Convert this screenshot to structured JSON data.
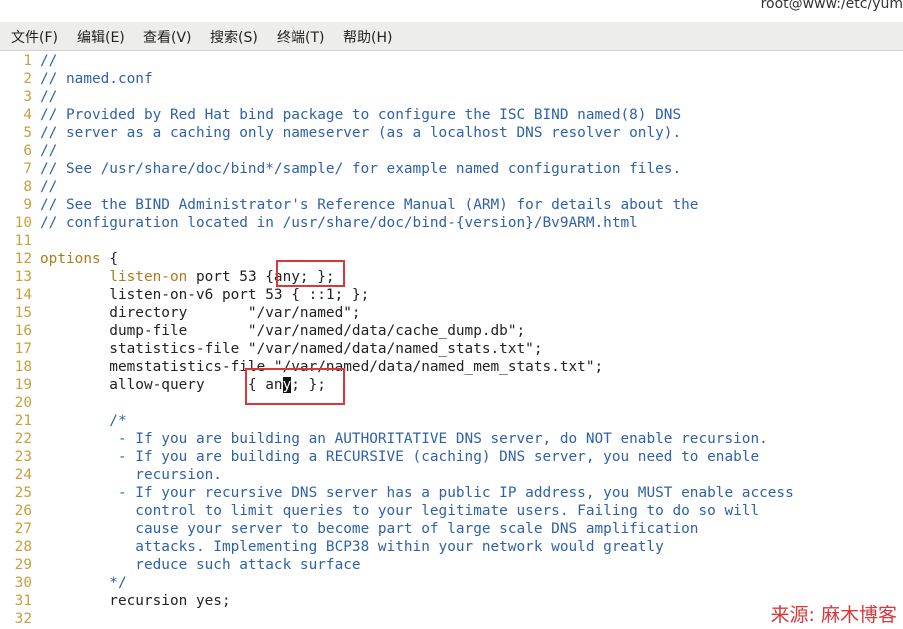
{
  "window": {
    "title": "root@www:/etc/yum"
  },
  "menu": [
    {
      "label": "文件(F)"
    },
    {
      "label": "编辑(E)"
    },
    {
      "label": "查看(V)"
    },
    {
      "label": "搜索(S)"
    },
    {
      "label": "终端(T)"
    },
    {
      "label": "帮助(H)"
    }
  ],
  "lines": [
    {
      "n": "1",
      "segs": [
        {
          "t": "//",
          "c": "cm"
        }
      ]
    },
    {
      "n": "2",
      "segs": [
        {
          "t": "// named.conf",
          "c": "cm"
        }
      ]
    },
    {
      "n": "3",
      "segs": [
        {
          "t": "//",
          "c": "cm"
        }
      ]
    },
    {
      "n": "4",
      "segs": [
        {
          "t": "// Provided by Red Hat bind package to configure the ISC BIND named(8) DNS",
          "c": "cm"
        }
      ]
    },
    {
      "n": "5",
      "segs": [
        {
          "t": "// server as a caching only nameserver (as a localhost DNS resolver only).",
          "c": "cm"
        }
      ]
    },
    {
      "n": "6",
      "segs": [
        {
          "t": "//",
          "c": "cm"
        }
      ]
    },
    {
      "n": "7",
      "segs": [
        {
          "t": "// See /usr/share/doc/bind*/sample/ for example named configuration files.",
          "c": "cm"
        }
      ]
    },
    {
      "n": "8",
      "segs": [
        {
          "t": "//",
          "c": "cm"
        }
      ]
    },
    {
      "n": "9",
      "segs": [
        {
          "t": "// See the BIND Administrator's Reference Manual (ARM) for details about the",
          "c": "cm"
        }
      ]
    },
    {
      "n": "10",
      "segs": [
        {
          "t": "// configuration located in /usr/share/doc/bind-{version}/Bv9ARM.html",
          "c": "cm"
        }
      ]
    },
    {
      "n": "11",
      "segs": []
    },
    {
      "n": "12",
      "segs": [
        {
          "t": "options",
          "c": "kw"
        },
        {
          "t": " {",
          "c": "tx"
        }
      ]
    },
    {
      "n": "13",
      "segs": [
        {
          "t": "        ",
          "c": "tx"
        },
        {
          "t": "listen-on",
          "c": "kw"
        },
        {
          "t": " port 53 {any; };",
          "c": "tx"
        }
      ]
    },
    {
      "n": "14",
      "segs": [
        {
          "t": "        listen-on-v6 port 53 { ::1; };",
          "c": "tx"
        }
      ]
    },
    {
      "n": "15",
      "segs": [
        {
          "t": "        directory       \"/var/named\";",
          "c": "tx"
        }
      ]
    },
    {
      "n": "16",
      "segs": [
        {
          "t": "        dump-file       \"/var/named/data/cache_dump.db\";",
          "c": "tx"
        }
      ]
    },
    {
      "n": "17",
      "segs": [
        {
          "t": "        statistics-file \"/var/named/data/named_stats.txt\";",
          "c": "tx"
        }
      ]
    },
    {
      "n": "18",
      "segs": [
        {
          "t": "        memstatistics-file \"/var/named/data/named_mem_stats.txt\";",
          "c": "tx"
        }
      ]
    },
    {
      "n": "19",
      "segs": [
        {
          "t": "        allow-query     { an",
          "c": "tx"
        },
        {
          "t": "y",
          "c": "cursor"
        },
        {
          "t": "; };",
          "c": "tx"
        }
      ]
    },
    {
      "n": "20",
      "segs": []
    },
    {
      "n": "21",
      "segs": [
        {
          "t": "        /*",
          "c": "cm"
        }
      ]
    },
    {
      "n": "22",
      "segs": [
        {
          "t": "         - If you are building an AUTHORITATIVE DNS server, do NOT enable recursion.",
          "c": "cm"
        }
      ]
    },
    {
      "n": "23",
      "segs": [
        {
          "t": "         - If you are building a RECURSIVE (caching) DNS server, you need to enable",
          "c": "cm"
        }
      ]
    },
    {
      "n": "24",
      "segs": [
        {
          "t": "           recursion.",
          "c": "cm"
        }
      ]
    },
    {
      "n": "25",
      "segs": [
        {
          "t": "         - If your recursive DNS server has a public IP address, you MUST enable access",
          "c": "cm"
        }
      ]
    },
    {
      "n": "26",
      "segs": [
        {
          "t": "           control to limit queries to your legitimate users. Failing to do so will",
          "c": "cm"
        }
      ]
    },
    {
      "n": "27",
      "segs": [
        {
          "t": "           cause your server to become part of large scale DNS amplification",
          "c": "cm"
        }
      ]
    },
    {
      "n": "28",
      "segs": [
        {
          "t": "           attacks. Implementing BCP38 within your network would greatly",
          "c": "cm"
        }
      ]
    },
    {
      "n": "29",
      "segs": [
        {
          "t": "           reduce such attack surface",
          "c": "cm"
        }
      ]
    },
    {
      "n": "30",
      "segs": [
        {
          "t": "        */",
          "c": "cm"
        }
      ]
    },
    {
      "n": "31",
      "segs": [
        {
          "t": "        recursion yes;",
          "c": "tx"
        }
      ]
    },
    {
      "n": "32",
      "segs": []
    }
  ],
  "watermark": "来源: 麻木博客",
  "colors": {
    "comment": "#2f62a8",
    "keyword": "#b07a1a",
    "line_number": "#c8a03c",
    "highlight_box": "#d9383a"
  }
}
